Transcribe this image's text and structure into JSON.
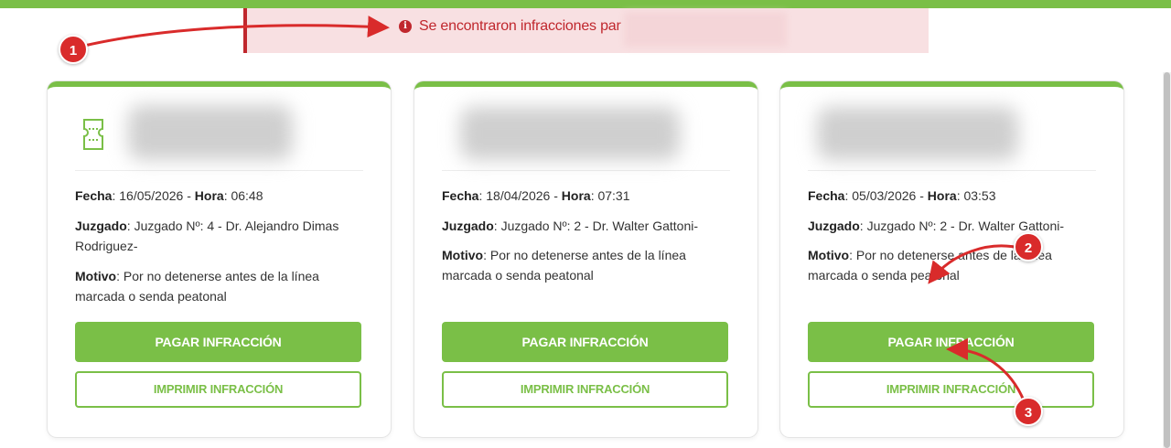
{
  "alert": {
    "message": "Se encontraron infracciones par"
  },
  "labels": {
    "fecha": "Fecha",
    "hora": "Hora",
    "juzgado": "Juzgado",
    "motivo": "Motivo",
    "pay_button": "PAGAR INFRACCIÓN",
    "print_button": "IMPRIMIR INFRACCIÓN"
  },
  "infractions": [
    {
      "fecha": "16/05/2026",
      "hora": "06:48",
      "juzgado": "Juzgado Nº: 4 - Dr. Alejandro Dimas Rodriguez-",
      "motivo": "Por no detenerse antes de la línea marcada o senda peatonal"
    },
    {
      "fecha": "18/04/2026",
      "hora": "07:31",
      "juzgado": "Juzgado Nº: 2 - Dr. Walter Gattoni-",
      "motivo": "Por no detenerse antes de la línea marcada o senda peatonal"
    },
    {
      "fecha": "05/03/2026",
      "hora": "03:53",
      "juzgado": "Juzgado Nº: 2 - Dr. Walter Gattoni-",
      "motivo": "Por no detenerse antes de la línea marcada o senda peatonal"
    }
  ],
  "annotations": {
    "markers": [
      "1",
      "2",
      "3"
    ]
  },
  "colors": {
    "brand_green": "#7abf47",
    "alert_red": "#c0272d",
    "marker_red": "#d92b2b"
  },
  "icons": {
    "alert": "info-circle-icon",
    "card": "ticket-icon"
  }
}
